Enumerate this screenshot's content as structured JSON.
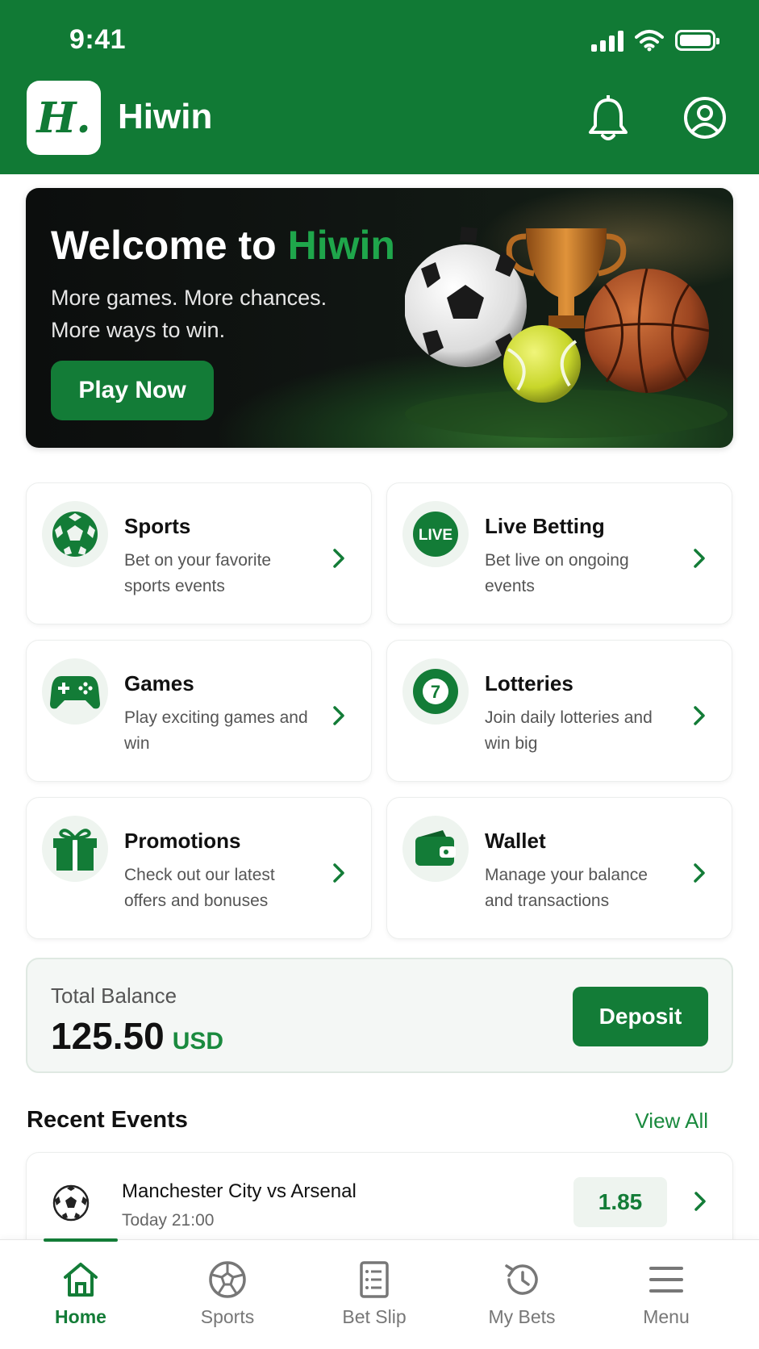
{
  "status_bar": {
    "time": "9:41"
  },
  "header": {
    "logo_text": "H.",
    "app_name": "Hiwin"
  },
  "hero": {
    "title_prefix": "Welcome to ",
    "title_brand": "Hiwin",
    "subtitle_line1": "More games. More chances.",
    "subtitle_line2": "More ways to win.",
    "cta": "Play Now"
  },
  "categories": [
    {
      "title": "Sports",
      "desc": "Bet on your favorite sports events",
      "icon": "soccer-ball-icon"
    },
    {
      "title": "Live Betting",
      "desc": "Bet live on ongoing events",
      "icon": "live-badge-icon",
      "badge": "LIVE"
    },
    {
      "title": "Games",
      "desc": "Play exciting games and win",
      "icon": "gamepad-icon"
    },
    {
      "title": "Lotteries",
      "desc": "Join daily lotteries and win big",
      "icon": "lottery-ball-icon",
      "badge": "7"
    },
    {
      "title": "Promotions",
      "desc": "Check out our latest offers and bonuses",
      "icon": "gift-icon"
    },
    {
      "title": "Wallet",
      "desc": "Manage your balance and transactions",
      "icon": "wallet-icon"
    }
  ],
  "balance": {
    "label": "Total Balance",
    "amount": "125.50",
    "currency": "USD",
    "deposit_label": "Deposit"
  },
  "recent_events": {
    "title": "Recent Events",
    "view_all": "View All",
    "items": [
      {
        "name": "Manchester City vs Arsenal",
        "time": "Today 21:00",
        "odds": "1.85"
      }
    ]
  },
  "bottom_nav": [
    {
      "label": "Home",
      "icon": "home-icon",
      "active": true
    },
    {
      "label": "Sports",
      "icon": "soccer-ball-icon",
      "active": false
    },
    {
      "label": "Bet Slip",
      "icon": "bet-slip-icon",
      "active": false
    },
    {
      "label": "My Bets",
      "icon": "history-icon",
      "active": false
    },
    {
      "label": "Menu",
      "icon": "menu-icon",
      "active": false
    }
  ],
  "colors": {
    "brand_green": "#117a35",
    "accent_green": "#1fa64b",
    "text_dark": "#111111",
    "text_muted": "#555555"
  }
}
